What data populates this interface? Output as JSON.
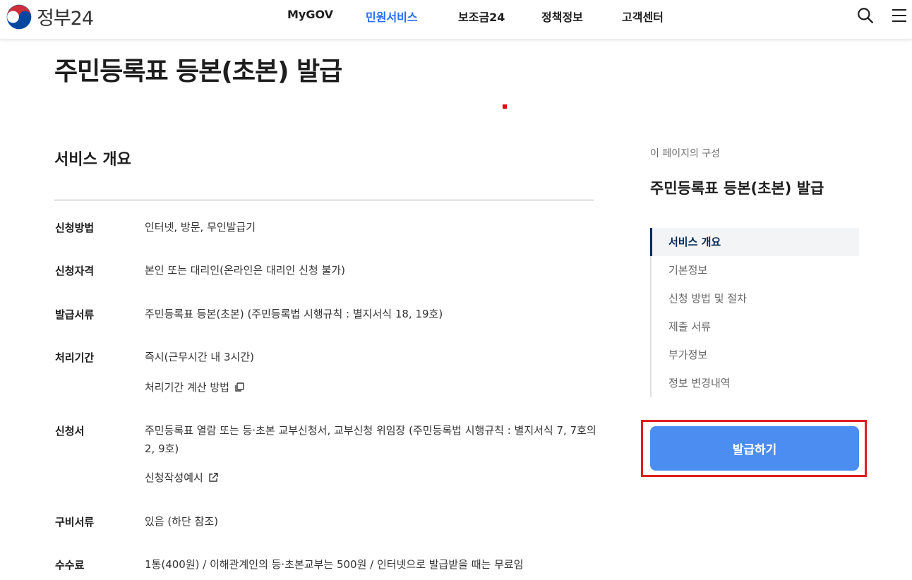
{
  "header": {
    "logo_text": "정부24",
    "nav": [
      {
        "label": "MyGOV",
        "active": false
      },
      {
        "label": "민원서비스",
        "active": true
      },
      {
        "label": "보조금24",
        "active": false
      },
      {
        "label": "정책정보",
        "active": false
      },
      {
        "label": "고객센터",
        "active": false
      }
    ],
    "icons": [
      "search-icon",
      "menu-icon"
    ]
  },
  "page": {
    "title": "주민등록표 등본(초본) 발급"
  },
  "overview": {
    "section_title": "서비스 개요",
    "rows": [
      {
        "label": "신청방법",
        "value": "인터넷, 방문, 무인발급기"
      },
      {
        "label": "신청자격",
        "value": "본인 또는 대리인(온라인은 대리인 신청 불가)"
      },
      {
        "label": "발급서류",
        "value": "주민등록표 등본(초본) (주민등록법 시행규칙 : 별지서식 18, 19호)"
      },
      {
        "label": "처리기간",
        "value": "즉시(근무시간 내 3시간)",
        "link": "처리기간 계산 방법"
      },
      {
        "label": "신청서",
        "value": "주민등록표 열람 또는 등·초본 교부신청서, 교부신청 위임장 (주민등록법 시행규칙 : 별지서식 7, 7호의2, 9호)",
        "link": "신청작성예시"
      },
      {
        "label": "구비서류",
        "value": "있음 (하단 참조)"
      },
      {
        "label": "수수료",
        "value": "1통(400원) / 이해관계인의 등·초본교부는 500원 / 인터넷으로 발급받을 때는 무료임"
      }
    ]
  },
  "aside": {
    "caption": "이 페이지의 구성",
    "title": "주민등록표 등본(초본) 발급",
    "toc": [
      {
        "label": "서비스 개요",
        "active": true
      },
      {
        "label": "기본정보",
        "active": false
      },
      {
        "label": "신청 방법 및 절차",
        "active": false
      },
      {
        "label": "제출 서류",
        "active": false
      },
      {
        "label": "부가정보",
        "active": false
      },
      {
        "label": "정보 변경내역",
        "active": false
      }
    ],
    "issue_button": "발급하기"
  },
  "colors": {
    "accent": "#256ef4",
    "button": "#4c8df1",
    "highlight": "#e01e1e"
  }
}
